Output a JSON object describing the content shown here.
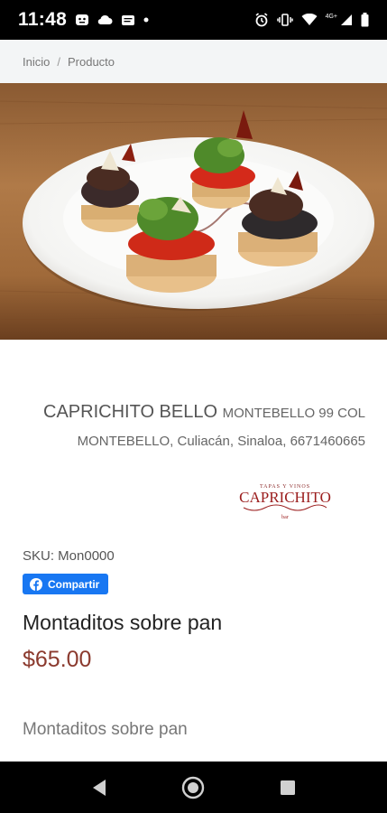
{
  "status_bar": {
    "time": "11:48",
    "network_label": "4G+"
  },
  "breadcrumb": {
    "home": "Inicio",
    "separator": "/",
    "current": "Producto"
  },
  "store": {
    "name": "CAPRICHITO BELLO",
    "address_line1": "MONTEBELLO 99 COL",
    "address_line2": "MONTEBELLO, Culiacán, Sinaloa, 6671460665",
    "logo_text": "CAPRICHITO",
    "logo_tagline": "TAPAS Y VINOS",
    "logo_sub": "bar"
  },
  "product": {
    "sku": "SKU: Mon0000",
    "share_label": "Compartir",
    "title": "Montaditos sobre pan",
    "price": "$65.00",
    "description": "Montaditos sobre pan"
  },
  "colors": {
    "price": "#8b3a2e",
    "facebook": "#1877f2",
    "breadcrumb_bg": "#f3f5f6"
  }
}
